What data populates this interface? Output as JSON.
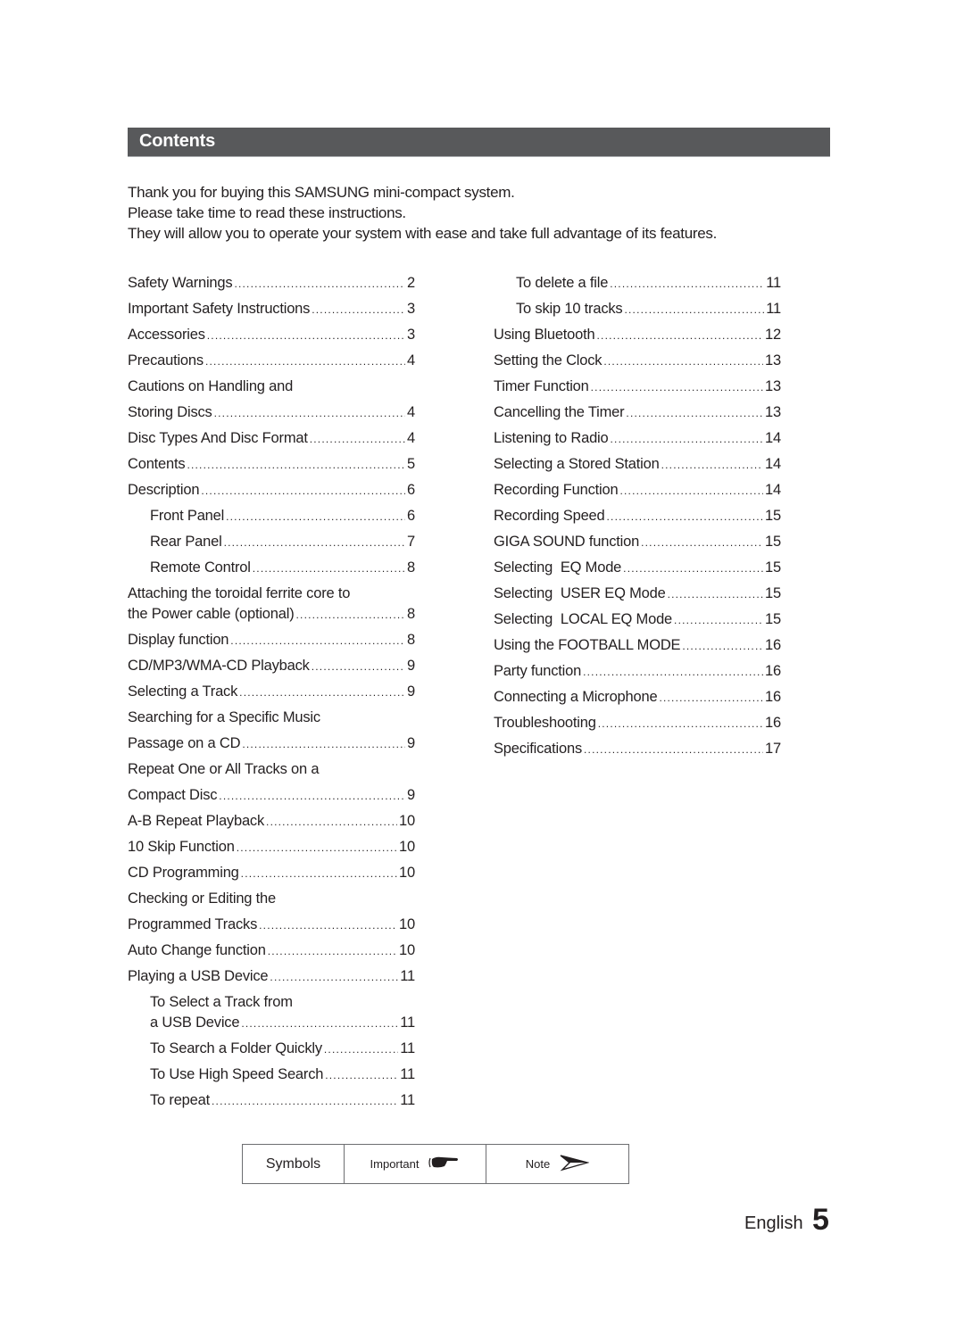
{
  "header": {
    "title": "Contents"
  },
  "intro": [
    "Thank you for buying this SAMSUNG mini-compact system.",
    "Please take time to read these instructions.",
    "They will allow you to operate your system with ease and take full advantage of its features."
  ],
  "toc_left": [
    {
      "title": "Safety Warnings",
      "page": "2"
    },
    {
      "title": "Important Safety Instructions",
      "page": "3"
    },
    {
      "title": "Accessories",
      "page": "3"
    },
    {
      "title": "Precautions",
      "page": "4"
    },
    {
      "title": "Cautions on Handling and",
      "page": ""
    },
    {
      "title": "Storing Discs",
      "page": "4"
    },
    {
      "title": "Disc Types And Disc Format",
      "page": "4"
    },
    {
      "title": "Contents",
      "page": "5"
    },
    {
      "title": "Description",
      "page": "6"
    },
    {
      "title": "Front Panel",
      "page": "6"
    },
    {
      "title": "Rear Panel",
      "page": "7"
    },
    {
      "title": "Remote Control",
      "page": "8"
    },
    {
      "title": "Attaching the toroidal ferrite core to",
      "title2": "the Power cable (optional)",
      "page": "8"
    },
    {
      "title": "Display function",
      "page": "8"
    },
    {
      "title": "CD/MP3/WMA-CD Playback",
      "page": "9"
    },
    {
      "title": "Selecting a Track",
      "page": "9"
    },
    {
      "title": "Searching for a Specific Music",
      "page": ""
    },
    {
      "title": "Passage on a CD",
      "page": "9"
    },
    {
      "title": "Repeat One or All Tracks on a",
      "page": ""
    },
    {
      "title": "Compact Disc",
      "page": "9"
    },
    {
      "title": "A-B Repeat Playback",
      "page": "10"
    },
    {
      "title": "10 Skip Function",
      "page": "10"
    },
    {
      "title": "CD Programming",
      "page": "10"
    },
    {
      "title": "Checking or Editing the",
      "page": ""
    },
    {
      "title": "Programmed Tracks",
      "page": "10"
    },
    {
      "title": "Auto Change function",
      "page": "10"
    },
    {
      "title": "Playing a USB Device",
      "page": "11"
    },
    {
      "title": "To Select a Track from",
      "title2": "a USB Device",
      "page": "11"
    },
    {
      "title": "To Search a Folder Quickly",
      "page": "11"
    },
    {
      "title": "To Use High Speed Search",
      "page": "11"
    },
    {
      "title": "To repeat",
      "page": "11"
    }
  ],
  "toc_right": [
    {
      "title": "To delete a file",
      "page": "11"
    },
    {
      "title": "To skip 10 tracks",
      "page": "11"
    },
    {
      "title": "Using Bluetooth",
      "page": "12"
    },
    {
      "title": "Setting the Clock",
      "page": "13"
    },
    {
      "title": "Timer Function",
      "page": "13"
    },
    {
      "title": "Cancelling the Timer",
      "page": "13"
    },
    {
      "title": "Listening to Radio",
      "page": "14"
    },
    {
      "title": "Selecting a Stored Station",
      "page": "14"
    },
    {
      "title": "Recording Function",
      "page": "14"
    },
    {
      "title": "Recording Speed",
      "page": "15"
    },
    {
      "title": "GIGA SOUND function",
      "page": "15"
    },
    {
      "title": "Selecting  EQ Mode",
      "page": "15"
    },
    {
      "title": "Selecting  USER EQ Mode",
      "page": "15"
    },
    {
      "title": "Selecting  LOCAL EQ Mode",
      "page": "15"
    },
    {
      "title": "Using the FOOTBALL MODE",
      "page": "16"
    },
    {
      "title": "Party function",
      "page": "16"
    },
    {
      "title": "Connecting a Microphone",
      "page": "16"
    },
    {
      "title": "Troubleshooting",
      "page": "16"
    },
    {
      "title": "Specifications",
      "page": "17"
    }
  ],
  "symbols": {
    "label": "Symbols",
    "important": "Important",
    "important_icon": "pointing-hand-icon",
    "note": "Note",
    "note_icon": "arrow-pointer-icon"
  },
  "footer": {
    "language": "English",
    "page_number": "5"
  }
}
